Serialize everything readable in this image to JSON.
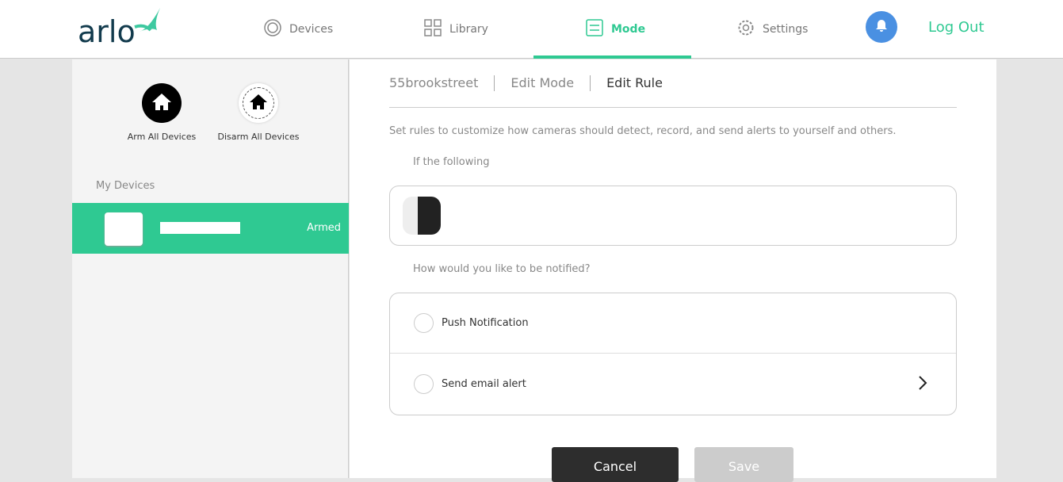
{
  "header": {
    "logo": "arlo",
    "nav": [
      {
        "label": "Devices",
        "icon": "devices-icon"
      },
      {
        "label": "Library",
        "icon": "library-icon"
      },
      {
        "label": "Mode",
        "icon": "mode-icon",
        "active": true
      },
      {
        "label": "Settings",
        "icon": "gear-icon"
      }
    ],
    "logout": "Log Out"
  },
  "sidebar": {
    "arm_label": "Arm All Devices",
    "disarm_label": "Disarm All Devices",
    "my_devices": "My Devices",
    "device": {
      "status": "Armed"
    }
  },
  "main": {
    "breadcrumb": [
      "55brookstreet",
      "Edit Mode",
      "Edit Rule"
    ],
    "description": "Set rules to customize how cameras should detect, record, and send alerts to yourself and others.",
    "if_label": "If the following",
    "notify_label": "How would you like to be notified?",
    "options": [
      "Push Notification",
      "Send email alert"
    ],
    "cancel": "Cancel",
    "save": "Save"
  },
  "colors": {
    "accent": "#2fc992",
    "bell": "#4a90e2"
  }
}
